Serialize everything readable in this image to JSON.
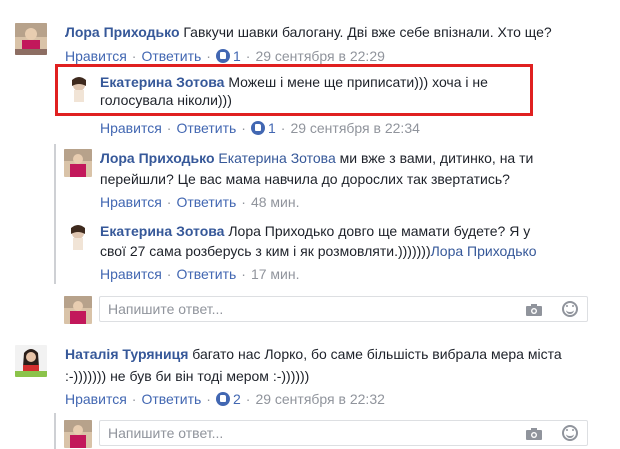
{
  "comments": [
    {
      "author": "Лора Приходько",
      "text": "Гавкучи шавки балогану. Дві вже себе впізнали. Хто ще?",
      "like_label": "Нравится",
      "reply_label": "Ответить",
      "like_count": "1",
      "time": "29 сентября в 22:29"
    },
    {
      "author": "Екатерина Зотова",
      "text_line1": "Можеш і мене ще приписати))) хоча і не",
      "text_line2": "голосувала ніколи)))",
      "like_label": "Нравится",
      "reply_label": "Ответить",
      "like_count": "1",
      "time": "29 сентября в 22:34"
    },
    {
      "author": "Лора Приходько",
      "mention": "Екатерина Зотова",
      "text_line1": "ми вже з вами, дитинко, на ти",
      "text_line2": "перейшли? Це вас мама навчила до дорослих так звертатись?",
      "like_label": "Нравится",
      "reply_label": "Ответить",
      "time": "48 мин."
    },
    {
      "author": "Екатерина Зотова",
      "text_line1": "Лора Приходько довго ще мамати будете? Я у",
      "text_line2": "свої 27 сама розберусь з ким і як розмовляти.)))))))",
      "mention_end": "Лора Приходько",
      "like_label": "Нравится",
      "reply_label": "Ответить",
      "time": "17 мин."
    },
    {
      "author": "Наталія Туряниця",
      "text_line1": "багато нас Лорко, бо саме більшість вибрала мера міста",
      "text_line2": ":-))))))) не був би він тоді мером :-))))))",
      "like_label": "Нравится",
      "reply_label": "Ответить",
      "like_count": "2",
      "time": "29 сентября в 22:32"
    }
  ],
  "reply_boxes": [
    {
      "placeholder": "Напишите ответ..."
    },
    {
      "placeholder": "Напишите ответ..."
    }
  ],
  "separator": "·",
  "colors": {
    "link": "#365899",
    "action": "#4267b2",
    "muted": "#90949c",
    "highlight": "#e02020"
  }
}
